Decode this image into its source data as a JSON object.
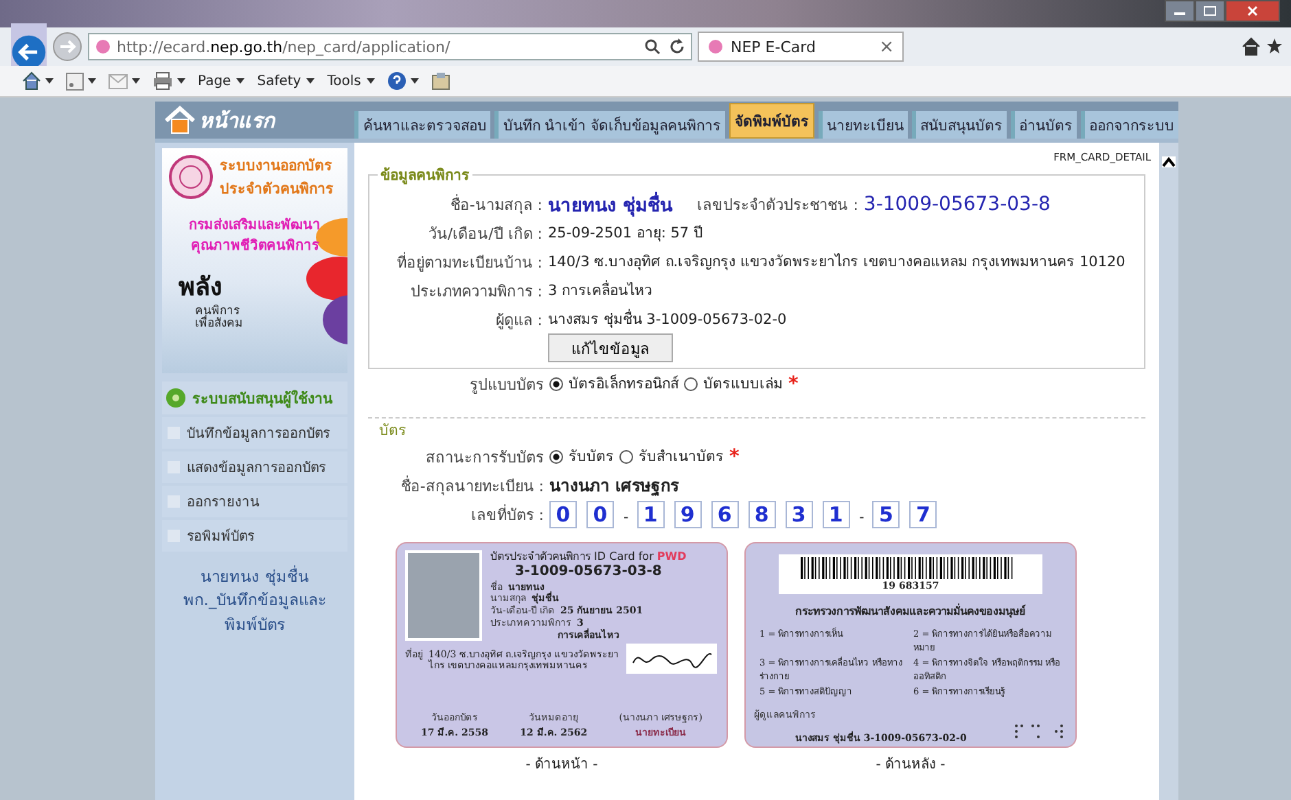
{
  "browser": {
    "url": "http://ecard.**nep.go.th**/nep_card/application/",
    "tab_title": "NEP E-Card",
    "tab_close": "×",
    "menus": [
      "Page",
      "Safety",
      "Tools"
    ]
  },
  "site": {
    "home_label": "หน้าแรก",
    "tabs": [
      {
        "label": "ค้นหาและตรวจสอบ",
        "selected": false
      },
      {
        "label": "บันทึก นำเข้า จัดเก็บข้อมูลคนพิการ",
        "selected": false
      },
      {
        "label": "จัดพิมพ์บัตร",
        "selected": true
      },
      {
        "label": "นายทะเบียน",
        "selected": false
      },
      {
        "label": "สนับสนุนบัตร",
        "selected": false
      },
      {
        "label": "อ่านบัตร",
        "selected": false
      },
      {
        "label": "ออกจากระบบ",
        "selected": false
      }
    ]
  },
  "sidebar": {
    "banner": {
      "title_lines": [
        "ระบบงานออกบัตร",
        "ประจำตัวคนพิการ"
      ],
      "dept_lines": [
        "กรมส่งเสริมและพัฒนา",
        "คุณภาพชีวิตคนพิการ"
      ],
      "slogan": "พลัง",
      "slogan_lines": [
        "คนพิการ",
        "เพื่อสังคม"
      ]
    },
    "support_title": "ระบบสนับสนุนผู้ใช้งาน",
    "items": [
      {
        "label": "บันทึกข้อมูลการออกบัตร"
      },
      {
        "label": "แสดงข้อมูลการออกบัตร"
      },
      {
        "label": "ออกรายงาน"
      },
      {
        "label": "รอพิมพ์บัตร"
      }
    ],
    "user_lines": [
      "นายทนง ชุ่มชื่น",
      "พก._บันทึกข้อมูลและ",
      "พิมพ์บัตร"
    ]
  },
  "form": {
    "form_id": "FRM_CARD_DETAIL",
    "section_title": "ข้อมูลคนพิการ",
    "name": {
      "label": "ชื่อ-นามสกุล :",
      "value": "นายทนง ชุ่มชื่น"
    },
    "citizen_id": {
      "label": "เลขประจำตัวประชาชน :",
      "value": "3-1009-05673-03-8"
    },
    "fields": [
      {
        "label": "วัน/เดือน/ปี เกิด :",
        "value": "25-09-2501 อายุ: 57 ปี"
      },
      {
        "label": "ที่อยู่ตามทะเบียนบ้าน :",
        "value": "140/3 ซ.บางอุทิศ ถ.เจริญกรุง แขวงวัดพระยาไกร เขตบางคอแหลม กรุงเทพมหานคร 10120"
      },
      {
        "label": "ประเภทความพิการ :",
        "value": "3 การเคลื่อนไหว"
      },
      {
        "label": "ผู้ดูแล :",
        "value": "นางสมร ชุ่มชื่น 3-1009-05673-02-0"
      }
    ],
    "edit_button": "แก้ไขข้อมูล",
    "card_type": {
      "label": "รูปแบบบัตร",
      "required_mark": "*",
      "options": [
        {
          "label": "บัตรอิเล็กทรอนิกส์",
          "selected": true
        },
        {
          "label": "บัตรแบบเล่ม",
          "selected": false
        }
      ]
    },
    "card_section_title": "บัตร",
    "receive": {
      "label": "สถานะการรับบัตร",
      "required_mark": "*",
      "options": [
        {
          "label": "รับบัตร",
          "selected": true
        },
        {
          "label": "รับสำเนาบัตร",
          "selected": false
        }
      ]
    },
    "registrar": {
      "label": "ชื่อ-สกุลนายทะเบียน :",
      "value": "นางนภา  เศรษฐกร"
    },
    "card_number": {
      "label": "เลขที่บัตร :",
      "chars": [
        {
          "kind": "digit",
          "text": "0"
        },
        {
          "kind": "digit",
          "text": "0"
        },
        {
          "kind": "sep",
          "text": "-"
        },
        {
          "kind": "digit",
          "text": "1"
        },
        {
          "kind": "digit",
          "text": "9"
        },
        {
          "kind": "digit",
          "text": "6"
        },
        {
          "kind": "digit",
          "text": "8"
        },
        {
          "kind": "digit",
          "text": "3"
        },
        {
          "kind": "digit",
          "text": "1"
        },
        {
          "kind": "sep",
          "text": "-"
        },
        {
          "kind": "digit",
          "text": "5"
        },
        {
          "kind": "digit",
          "text": "7"
        }
      ]
    }
  },
  "cards": {
    "front": {
      "title": "บัตรประจำตัวคนพิการ ID Card for",
      "title_tag": "PWD",
      "id": "3-1009-05673-03-8",
      "rows": [
        {
          "label": "ชื่อ",
          "value": "นายทนง"
        },
        {
          "label": "นามสกุล",
          "value": "ชุ่มชื่น"
        },
        {
          "label": "วัน-เดือน-ปี เกิด",
          "value": "25 กันยายน 2501"
        },
        {
          "label": "ประเภทความพิการ",
          "value": "3"
        }
      ],
      "type_text": "การเคลื่อนไหว",
      "address_label": "ที่อยู่",
      "address": "140/3 ซ.บางอุทิศ ถ.เจริญกรุง แขวงวัดพระยาไกร เขตบางคอแหลมกรุงเทพมหานคร",
      "signer": "(นางนภา เศรษฐกร)",
      "signer_title": "นายทะเบียน",
      "dates": [
        {
          "label": "วันออกบัตร",
          "value": "17 มี.ค. 2558"
        },
        {
          "label": "วันหมดอายุ",
          "value": "12 มี.ค. 2562"
        }
      ],
      "caption": "- ด้านหน้า -"
    },
    "back": {
      "barcode_text": "19  683157",
      "ministry": "กระทรวงการพัฒนาสังคมและความมั่นคงของมนุษย์",
      "types": [
        "1 = พิการทางการเห็น",
        "2 = พิการทางการได้ยินหรือสื่อความหมาย",
        "3 = พิการทางการเคลื่อนไหว หรือทางร่างกาย",
        "4 = พิการทางจิตใจ หรือพฤติกรรม หรือออทิสติก",
        "5 = พิการทางสติปัญญา",
        "6 = พิการทางการเรียนรู้"
      ],
      "caretaker_label": "ผู้ดูแลคนพิการ",
      "caretaker": "นางสมร ชุ่มชื่น 3-1009-05673-02-0",
      "caption": "- ด้านหลัง -"
    }
  }
}
